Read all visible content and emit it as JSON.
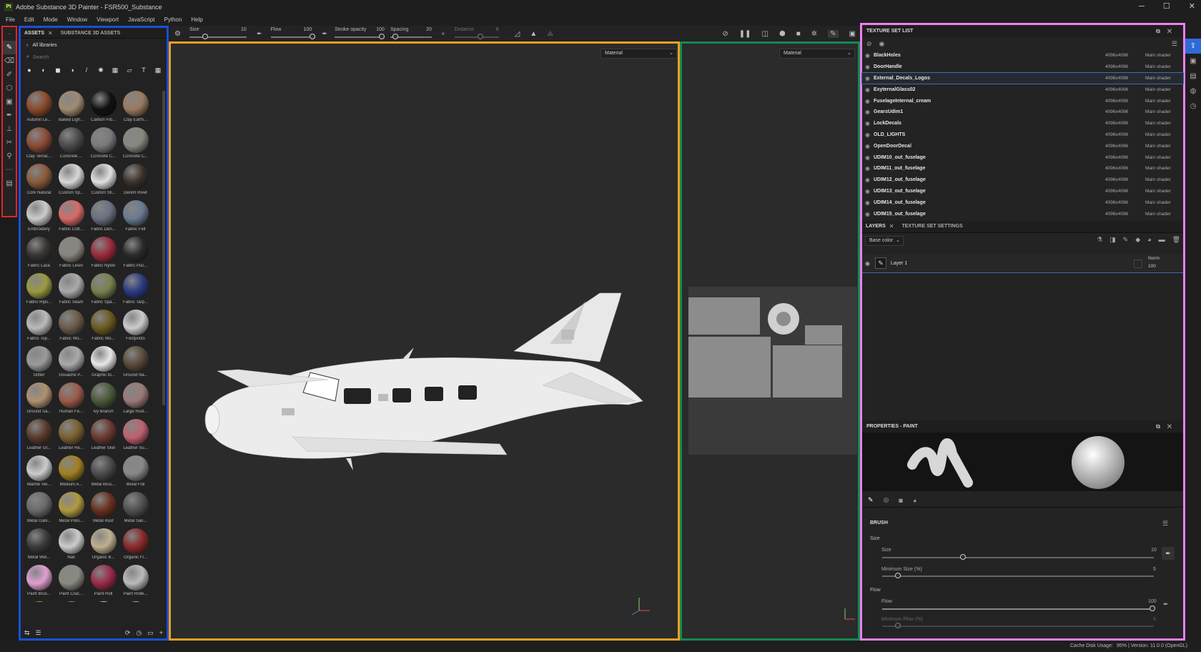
{
  "titlebar": {
    "app_badge": "Pt",
    "title": "Adobe Substance 3D Painter - FSR500_Substance",
    "min": "─",
    "max": "☐",
    "close": "✕"
  },
  "menu": [
    "File",
    "Edit",
    "Mode",
    "Window",
    "Viewport",
    "JavaScript",
    "Python",
    "Help"
  ],
  "assets": {
    "tab_assets": "ASSETS",
    "tab_close": "✕",
    "tab_s3d": "SUBSTANCE 3D ASSETS",
    "libraries": "All libraries",
    "search_placeholder": "Search",
    "items": [
      {
        "label": "Autumn Le...",
        "color": "#8a4a2a"
      },
      {
        "label": "Baked Ligh...",
        "color": "#a08a70"
      },
      {
        "label": "Carbon Fib...",
        "color": "#111111"
      },
      {
        "label": "Clay Earth...",
        "color": "#9a7a60"
      },
      {
        "label": "Clay Terrac...",
        "color": "#8a4a35"
      },
      {
        "label": "Concrete ...",
        "color": "#4a4a4a"
      },
      {
        "label": "Concrete C...",
        "color": "#7a7a7a"
      },
      {
        "label": "Concrete C...",
        "color": "#888880"
      },
      {
        "label": "Cork Natural",
        "color": "#8a5a3a"
      },
      {
        "label": "Custom Sp...",
        "color": "#d8d8d8"
      },
      {
        "label": "Custom Sti...",
        "color": "#e0e0e0"
      },
      {
        "label": "Denim Rivet",
        "color": "#3a3028"
      },
      {
        "label": "Embroidery",
        "color": "#cccccc"
      },
      {
        "label": "Fabric Cott...",
        "color": "#d86a68"
      },
      {
        "label": "Fabric Den...",
        "color": "#6a7080"
      },
      {
        "label": "Fabric Felt",
        "color": "#6a7a90"
      },
      {
        "label": "Fabric Lace",
        "color": "#3a3535"
      },
      {
        "label": "Fabric Linen",
        "color": "#8a8580"
      },
      {
        "label": "Fabric Nylon",
        "color": "#9a2a3a"
      },
      {
        "label": "Fabric Puc...",
        "color": "#2a2a2a"
      },
      {
        "label": "Fabric Rips...",
        "color": "#9a9a40"
      },
      {
        "label": "Fabric Seam",
        "color": "#aaaaaa"
      },
      {
        "label": "Fabric Spa...",
        "color": "#7a8050"
      },
      {
        "label": "Fabric Tarp...",
        "color": "#2a3a80"
      },
      {
        "label": "Fabric Top...",
        "color": "#bbbbbb"
      },
      {
        "label": "Fabric Wo...",
        "color": "#6a5a4a"
      },
      {
        "label": "Fabric Wo...",
        "color": "#6a5a20"
      },
      {
        "label": "Footprints",
        "color": "#cccccc"
      },
      {
        "label": "Glitter",
        "color": "#9a9a9a"
      },
      {
        "label": "Gouache P...",
        "color": "#aaaaaa"
      },
      {
        "label": "Graphic to...",
        "color": "#e8e8e8"
      },
      {
        "label": "Ground Na...",
        "color": "#5a4a3a"
      },
      {
        "label": "Ground Sa...",
        "color": "#b09070"
      },
      {
        "label": "Human Fe...",
        "color": "#9a5a48"
      },
      {
        "label": "Ivy Branch",
        "color": "#4a5a3a"
      },
      {
        "label": "Large Rust...",
        "color": "#9a7a78"
      },
      {
        "label": "Leather Gr...",
        "color": "#5a3a2a"
      },
      {
        "label": "Leather Re...",
        "color": "#7a6030"
      },
      {
        "label": "Leather Skin",
        "color": "#6a3a30"
      },
      {
        "label": "Leather Su...",
        "color": "#c06070"
      },
      {
        "label": "Marble Vei...",
        "color": "#cccccc"
      },
      {
        "label": "Medium A...",
        "color": "#a08020"
      },
      {
        "label": "Metal Brus...",
        "color": "#4a4a4a"
      },
      {
        "label": "Metal Foil",
        "color": "#888888"
      },
      {
        "label": "Metal Galv...",
        "color": "#6a6a6a"
      },
      {
        "label": "Metal Polis...",
        "color": "#b09a40"
      },
      {
        "label": "Metal Rust",
        "color": "#6a3020"
      },
      {
        "label": "Metal San...",
        "color": "#505050"
      },
      {
        "label": "Metal Wel...",
        "color": "#3a3a3a"
      },
      {
        "label": "Nail",
        "color": "#cccccc"
      },
      {
        "label": "Organic B...",
        "color": "#c0b090"
      },
      {
        "label": "Organic Fl...",
        "color": "#8a2a2a"
      },
      {
        "label": "Paint Brus...",
        "color": "#e0a0d0"
      },
      {
        "label": "Paint Crac...",
        "color": "#8a8a80"
      },
      {
        "label": "Paint Roll",
        "color": "#9a2a48"
      },
      {
        "label": "Paint Rolle...",
        "color": "#bbbbbb"
      },
      {
        "label": "",
        "color": "#e08a10"
      },
      {
        "label": "",
        "color": "#a08060"
      },
      {
        "label": "",
        "color": "#dddddd"
      },
      {
        "label": "",
        "color": "#bbbbb0"
      }
    ]
  },
  "toolbar": {
    "size_label": "Size",
    "size_val": "10",
    "flow_label": "Flow",
    "flow_val": "100",
    "stroke_label": "Stroke opacity",
    "stroke_val": "100",
    "spacing_label": "Spacing",
    "spacing_val": "20",
    "distance_label": "Distance",
    "distance_val": "8"
  },
  "viewport": {
    "material_3d": "Material",
    "material_2d": "Material"
  },
  "texture_sets": {
    "title": "TEXTURE SET LIST",
    "rows": [
      {
        "name": "BlackHoles",
        "res": "4096x4096",
        "shader": "Main shader"
      },
      {
        "name": "DoorHandle",
        "res": "4096x4096",
        "shader": "Main shader"
      },
      {
        "name": "External_Decals_Logos",
        "res": "4096x4096",
        "shader": "Main shader"
      },
      {
        "name": "ExyternalGlass02",
        "res": "4096x4096",
        "shader": "Main shader"
      },
      {
        "name": "FuselageInternal_cream",
        "res": "4096x4096",
        "shader": "Main shader"
      },
      {
        "name": "GearsUdim1",
        "res": "4096x4096",
        "shader": "Main shader"
      },
      {
        "name": "LockDecals",
        "res": "4096x4096",
        "shader": "Main shader"
      },
      {
        "name": "OLD_LIGHTS",
        "res": "4096x4096",
        "shader": "Main shader"
      },
      {
        "name": "OpenDoorDecal",
        "res": "4096x4096",
        "shader": "Main shader"
      },
      {
        "name": "UDIM10_out_fuselage",
        "res": "4096x4096",
        "shader": "Main shader"
      },
      {
        "name": "UDIM11_out_fuselage",
        "res": "4096x4096",
        "shader": "Main shader"
      },
      {
        "name": "UDIM12_out_fuselage",
        "res": "4096x4096",
        "shader": "Main shader"
      },
      {
        "name": "UDIM13_out_fuselage",
        "res": "4096x4096",
        "shader": "Main shader"
      },
      {
        "name": "UDIM14_out_fuselage",
        "res": "4096x4096",
        "shader": "Main shader"
      },
      {
        "name": "UDIM15_out_fuselage",
        "res": "4096x4096",
        "shader": "Main shader"
      }
    ]
  },
  "layers": {
    "tab_layers": "LAYERS",
    "tab_close": "✕",
    "tab_settings": "TEXTURE SET SETTINGS",
    "channel": "Base color",
    "layer_name": "Layer 1",
    "blend": "Norm",
    "opacity": "100"
  },
  "properties": {
    "title": "PROPERTIES - PAINT",
    "brush_title": "BRUSH",
    "size_group": "Size",
    "size_label": "Size",
    "size_val": "10",
    "min_size_label": "Minimum Size (%)",
    "min_size_val": "5",
    "flow_group": "Flow",
    "flow_label": "Flow",
    "flow_val": "100",
    "min_flow_label": "Minimum Flow (%)",
    "min_flow_val": "5"
  },
  "status": {
    "cache": "Cache Disk Usage:",
    "cache_val": "95% | Version: 11.0.0 (OpenGL)"
  },
  "colors": {
    "toolstrip_outline": "#e0262b",
    "assets_outline": "#1a4fd6",
    "viewport3d_outline": "#f0a020",
    "viewport2d_outline": "#138a52",
    "right_outline": "#f07ff0",
    "accent": "#2f6bd8"
  }
}
